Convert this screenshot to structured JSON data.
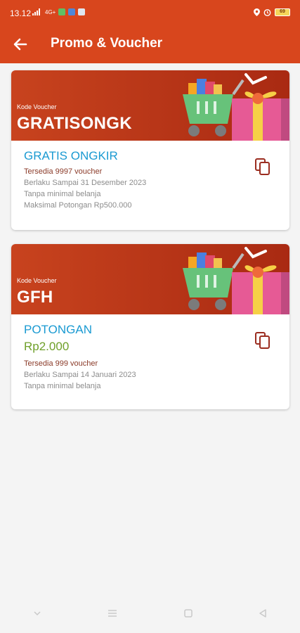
{
  "status_bar": {
    "time": "13.12",
    "network": "4G+",
    "battery": "69"
  },
  "header": {
    "title": "Promo & Voucher",
    "back_icon": "arrow-left-icon"
  },
  "colors": {
    "brand": "#d8461d",
    "type_blue": "#1a9ad2",
    "amount_green": "#6fa02a",
    "availability_red": "#8a3a28",
    "muted": "#8c8c8c"
  },
  "vouchers": [
    {
      "label": "Kode Voucher",
      "code": "GRATISONGK",
      "type": "GRATIS ONGKIR",
      "availability": "Tersedia 9997 voucher",
      "valid_until": "Berlaku Sampai 31 Desember 2023",
      "min_purchase": "Tanpa minimal belanja",
      "max_discount": "Maksimal Potongan Rp500.000",
      "copy_icon": "copy-icon"
    },
    {
      "label": "Kode Voucher",
      "code": "GFH",
      "type": "POTONGAN",
      "amount": "Rp2.000",
      "availability": "Tersedia 999 voucher",
      "valid_until": "Berlaku Sampai 14 Januari 2023",
      "min_purchase": "Tanpa minimal belanja",
      "copy_icon": "copy-icon"
    }
  ],
  "nav": {
    "down_icon": "chevron-down-icon",
    "menu_icon": "menu-icon",
    "home_icon": "home-square-icon",
    "back_icon": "back-triangle-icon"
  }
}
